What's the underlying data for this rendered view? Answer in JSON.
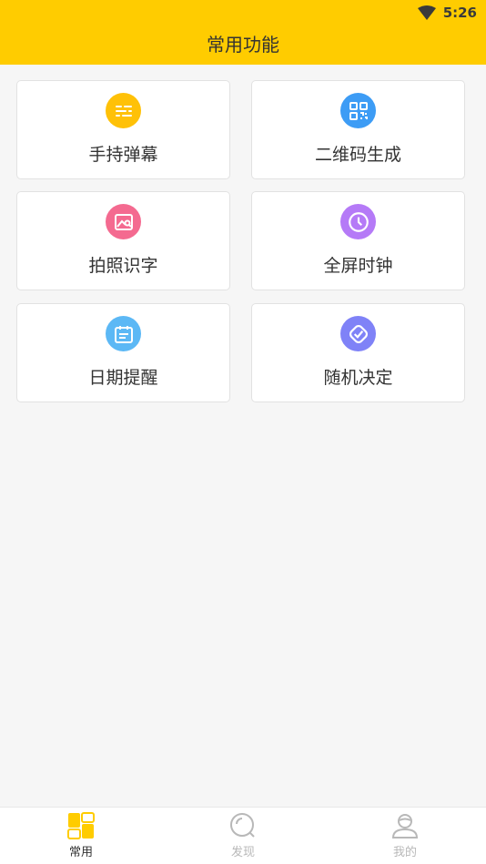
{
  "status_bar": {
    "time": "5:26"
  },
  "header": {
    "title": "常用功能"
  },
  "features": [
    {
      "label": "手持弹幕",
      "icon": "danmaku-icon",
      "color": "#ffc107"
    },
    {
      "label": "二维码生成",
      "icon": "qrcode-icon",
      "color": "#3d9cf5"
    },
    {
      "label": "拍照识字",
      "icon": "photo-scan-icon",
      "color": "#f46a90"
    },
    {
      "label": "全屏时钟",
      "icon": "clock-icon",
      "color": "#b57af7"
    },
    {
      "label": "日期提醒",
      "icon": "calendar-icon",
      "color": "#5cb8f5"
    },
    {
      "label": "随机决定",
      "icon": "random-icon",
      "color": "#7f82f7"
    }
  ],
  "tabs": [
    {
      "label": "常用",
      "icon": "common-icon",
      "active": true
    },
    {
      "label": "发现",
      "icon": "discover-icon",
      "active": false
    },
    {
      "label": "我的",
      "icon": "profile-icon",
      "active": false
    }
  ],
  "colors": {
    "accent": "#ffcc00",
    "tab_active_icon": "#ffcc00",
    "tab_inactive": "#b8b8b8"
  }
}
